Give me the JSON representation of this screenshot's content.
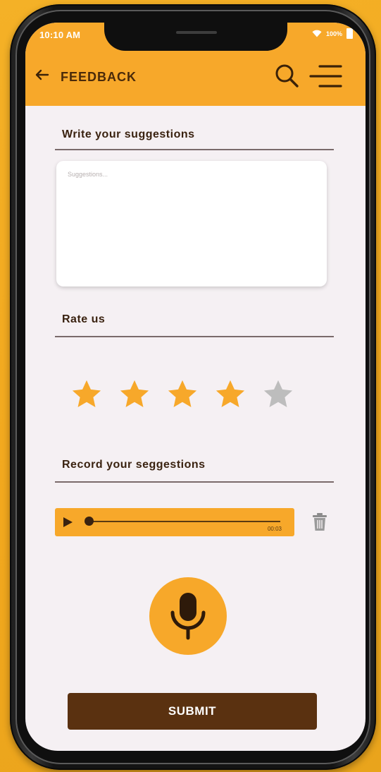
{
  "status_bar": {
    "time": "10:10 AM",
    "battery": "100%"
  },
  "header": {
    "title": "FEEDBACK",
    "icons": [
      "back-arrow-icon",
      "search-icon",
      "menu-icon"
    ]
  },
  "suggestions": {
    "label": "Write your suggestions",
    "placeholder": "Suggestions..."
  },
  "rating": {
    "label": "Rate us",
    "value": 4,
    "max": 5
  },
  "recording": {
    "label": "Record your seggestions",
    "duration": "00:03",
    "progress": 0
  },
  "submit": {
    "label": "SUBMIT"
  },
  "colors": {
    "accent": "#f7a82a",
    "dark": "#5a3110",
    "star_filled": "#f7a82a",
    "star_empty": "#bdbdbd",
    "background": "#f5f0f3"
  }
}
